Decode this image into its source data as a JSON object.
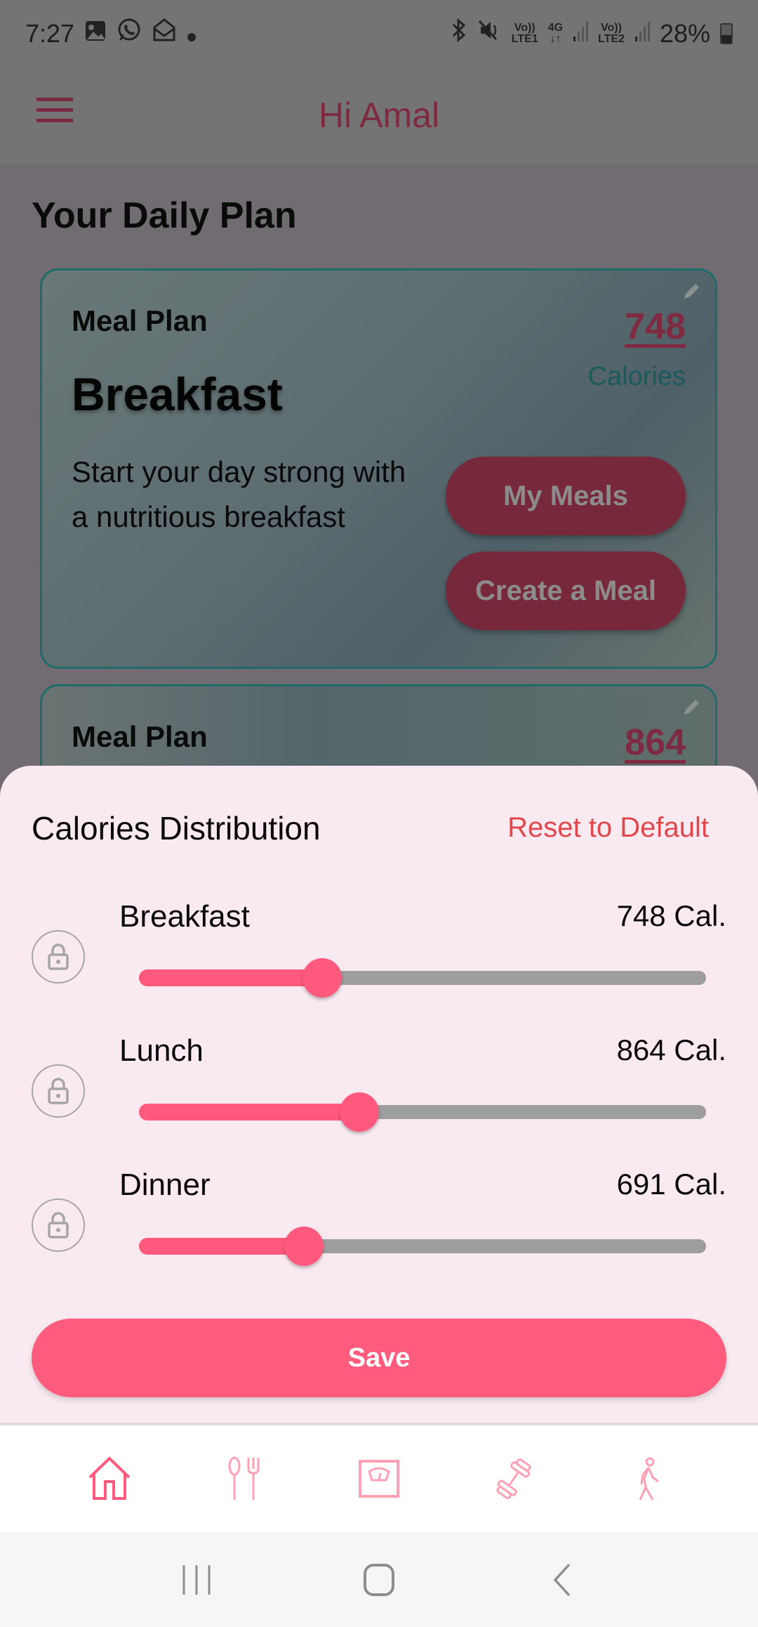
{
  "status_bar": {
    "time": "7:27",
    "left_icons": [
      "gallery-icon",
      "whatsapp-icon",
      "email-icon",
      "dot-icon"
    ],
    "right_icons": [
      "bluetooth-icon",
      "mute-icon",
      "volte-lte1-icon",
      "4g-icon",
      "signal-1-icon",
      "volte-lte2-icon",
      "signal-2-icon"
    ],
    "lte1_top": "Vo))",
    "lte1_bottom": "LTE1",
    "net_top": "4G",
    "net_bottom": "↓↑",
    "lte2_top": "Vo))",
    "lte2_bottom": "LTE2",
    "battery": "28%"
  },
  "header": {
    "title": "Hi Amal",
    "menu_icon": "hamburger-menu-icon"
  },
  "main": {
    "section_title": "Your Daily Plan",
    "cards": [
      {
        "label": "Meal Plan",
        "meal": "Breakfast",
        "description": "Start your day strong with a nutritious breakfast",
        "calories": "748",
        "calories_label": "Calories",
        "buttons": [
          "My Meals",
          "Create a Meal"
        ]
      },
      {
        "label": "Meal Plan",
        "calories": "864"
      }
    ]
  },
  "sheet": {
    "title": "Calories Distribution",
    "reset_label": "Reset to Default",
    "rows": [
      {
        "label": "Breakfast",
        "value": "748 Cal.",
        "fraction": 0.323
      },
      {
        "label": "Lunch",
        "value": "864 Cal.",
        "fraction": 0.389
      },
      {
        "label": "Dinner",
        "value": "691 Cal.",
        "fraction": 0.291
      }
    ],
    "save_label": "Save"
  },
  "colors": {
    "accent": "#ff5a7d",
    "card_button": "#78283b",
    "reset": "#e0484e",
    "track": "#9e9e9e",
    "sheet_bg": "#f9e9f0"
  },
  "bottom_nav": {
    "items": [
      "home-icon",
      "meals-icon",
      "scale-icon",
      "workout-icon",
      "activity-icon"
    ],
    "active": 0
  },
  "system_nav": [
    "recents-icon",
    "home-button-icon",
    "back-icon"
  ]
}
